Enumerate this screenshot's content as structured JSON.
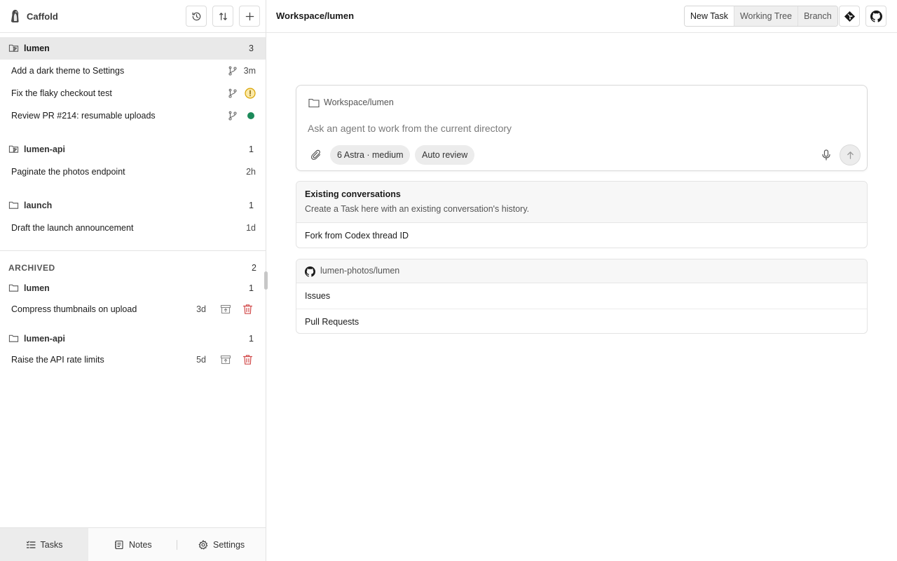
{
  "app": {
    "name": "Caffold"
  },
  "sidebar": {
    "groups": [
      {
        "name": "lumen",
        "count": "3"
      },
      {
        "name": "lumen-api",
        "count": "1"
      },
      {
        "name": "launch",
        "count": "1"
      }
    ],
    "tasks": [
      {
        "title": "Add a dark theme to Settings",
        "meta": "3m"
      },
      {
        "title": "Fix the flaky checkout test",
        "meta": ""
      },
      {
        "title": "Review PR #214: resumable uploads",
        "meta": ""
      },
      {
        "title": "Paginate the photos endpoint",
        "meta": "2h"
      },
      {
        "title": "Draft the launch announcement",
        "meta": "1d"
      }
    ],
    "archived": {
      "title": "ARCHIVED",
      "count": "2",
      "groups": [
        {
          "name": "lumen",
          "count": "1"
        },
        {
          "name": "lumen-api",
          "count": "1"
        }
      ],
      "tasks": [
        {
          "title": "Compress thumbnails on upload",
          "meta": "3d"
        },
        {
          "title": "Raise the API rate limits",
          "meta": "5d"
        }
      ]
    },
    "footer": {
      "tasks": "Tasks",
      "notes": "Notes",
      "settings": "Settings"
    }
  },
  "main": {
    "title": "Workspace/lumen",
    "segments": {
      "new_task": "New Task",
      "working_tree": "Working Tree",
      "branch": "Branch"
    },
    "composer": {
      "cwd": "Workspace/lumen",
      "placeholder": "Ask an agent to work from the current directory",
      "model_chip": "6 Astra  · medium",
      "review_chip": "Auto review"
    },
    "conversations": {
      "title": "Existing conversations",
      "subtitle": "Create a Task here with an existing conversation's history.",
      "fork": "Fork from Codex thread ID"
    },
    "repo": {
      "name": "lumen-photos/lumen",
      "issues": "Issues",
      "pulls": "Pull Requests"
    }
  },
  "colors": {
    "accent_green": "#1c8a5a",
    "warning_yellow": "#d9a300",
    "danger_red": "#d24b4b"
  }
}
